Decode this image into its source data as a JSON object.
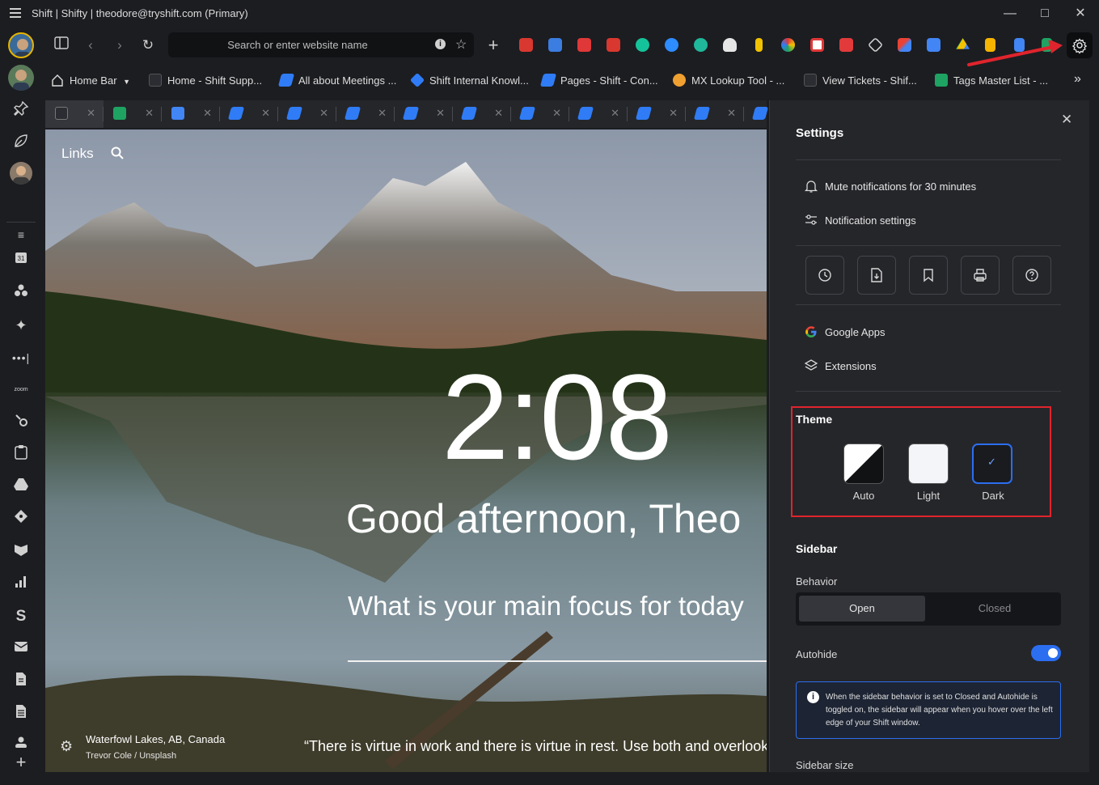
{
  "window": {
    "title": "Shift | Shifty | theodore@tryshift.com (Primary)"
  },
  "toolbar": {
    "search_placeholder": "Search or enter website name"
  },
  "bookmarks": [
    {
      "label": "Home Bar",
      "color": "#1c1d21"
    },
    {
      "label": "Home - Shift Supp...",
      "color": "#2c2d33"
    },
    {
      "label": "All about Meetings ...",
      "color": "#2f7cf6"
    },
    {
      "label": "Shift Internal Knowl...",
      "color": "#2f7cf6"
    },
    {
      "label": "Pages - Shift - Con...",
      "color": "#2f7cf6"
    },
    {
      "label": "MX Lookup Tool - ...",
      "color": "#f0a030"
    },
    {
      "label": "View Tickets - Shif...",
      "color": "#2c2d33"
    },
    {
      "label": "Tags Master List - ...",
      "color": "#1ea362"
    }
  ],
  "content": {
    "links_label": "Links",
    "clock": "2:08",
    "greeting": "Good afternoon, Theo",
    "focus_prompt": "What is your main focus for today",
    "location": "Waterfowl Lakes, AB, Canada",
    "photo_credit": "Trevor Cole / Unsplash",
    "quote": "“There is virtue in work and there is virtue in rest. Use both and overlook"
  },
  "settings": {
    "title": "Settings",
    "mute": "Mute notifications for 30 minutes",
    "notification_settings": "Notification settings",
    "google_apps": "Google Apps",
    "extensions": "Extensions",
    "theme": {
      "title": "Theme",
      "options": [
        "Auto",
        "Light",
        "Dark"
      ],
      "selected": "Dark"
    },
    "sidebar": {
      "title": "Sidebar",
      "behavior_label": "Behavior",
      "open": "Open",
      "closed": "Closed",
      "selected": "Open",
      "autohide_label": "Autohide",
      "autohide_on": true,
      "info": "When the sidebar behavior is set to Closed and Autohide is toggled on, the sidebar will appear when you hover over the left edge of your Shift window.",
      "size_label": "Sidebar size"
    }
  },
  "colors": {
    "accent": "#2b6ef0",
    "highlight": "#e0242d",
    "panel": "#25262a",
    "bg": "#1c1d21"
  }
}
